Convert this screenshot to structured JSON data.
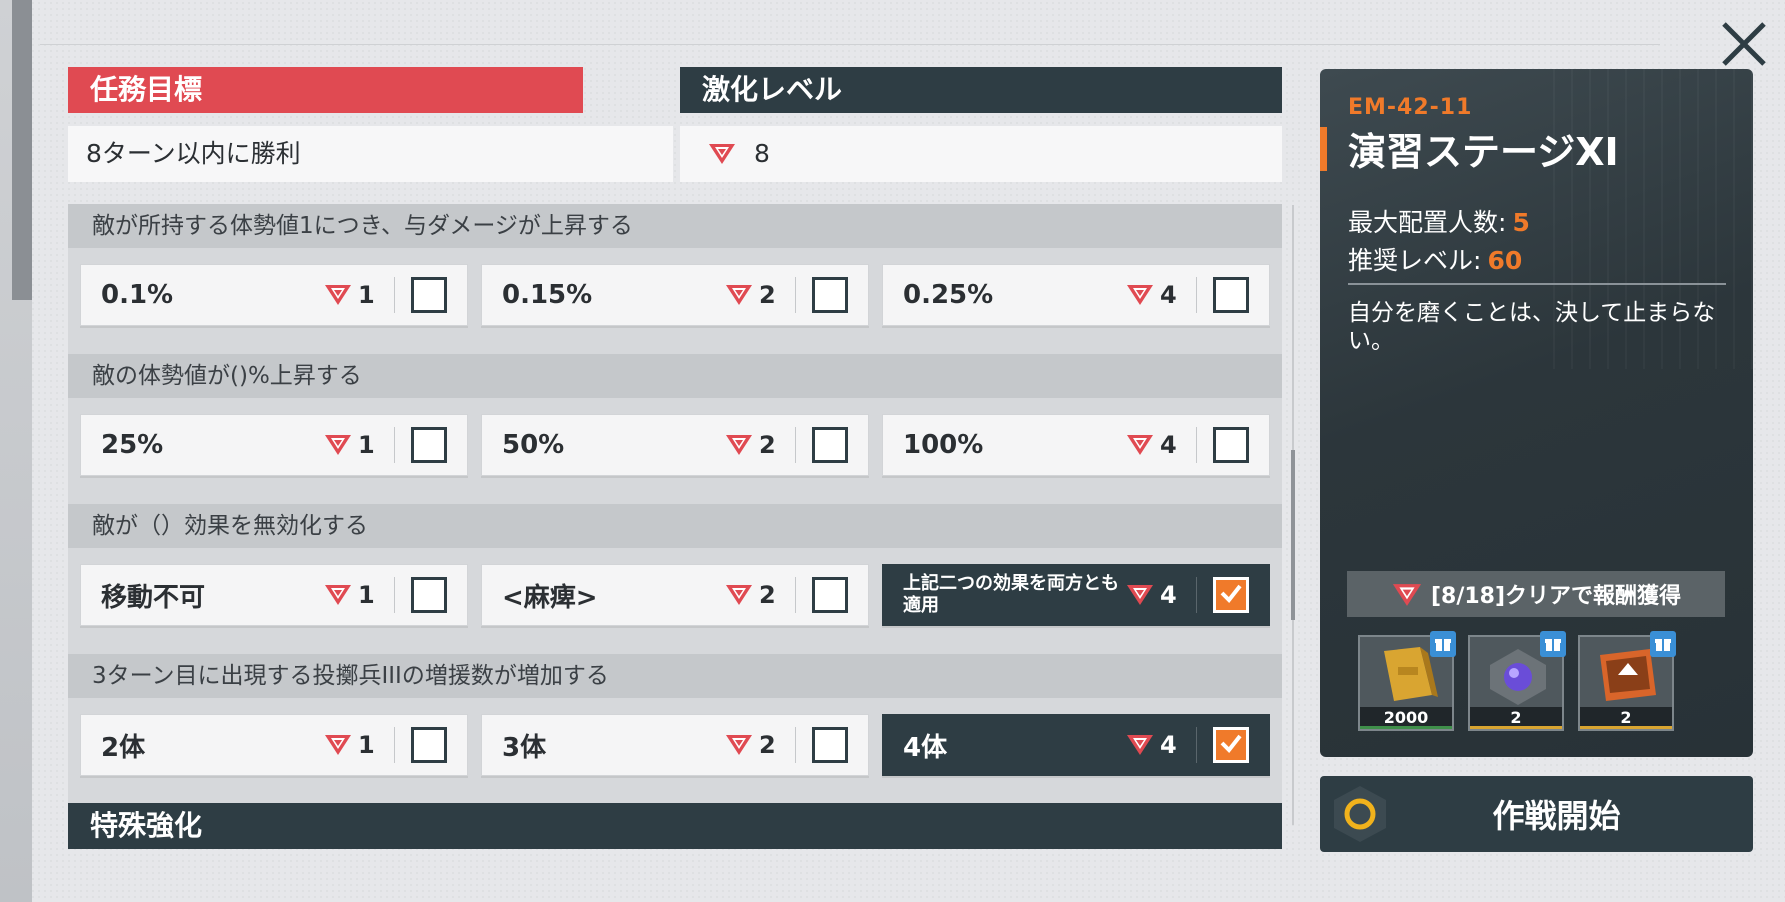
{
  "objective": {
    "title": "任務目標",
    "value": "8ターン以内に勝利"
  },
  "intensity": {
    "title": "激化レベル",
    "value": "8"
  },
  "sections": [
    {
      "title": "敵が所持する体勢値1につき、与ダメージが上昇する",
      "options": [
        {
          "label": "0.1%",
          "cost": "1",
          "checked": false
        },
        {
          "label": "0.15%",
          "cost": "2",
          "checked": false
        },
        {
          "label": "0.25%",
          "cost": "4",
          "checked": false
        }
      ]
    },
    {
      "title": "敵の体勢値が()%上昇する",
      "options": [
        {
          "label": "25%",
          "cost": "1",
          "checked": false
        },
        {
          "label": "50%",
          "cost": "2",
          "checked": false
        },
        {
          "label": "100%",
          "cost": "4",
          "checked": false
        }
      ]
    },
    {
      "title": "敵が（）効果を無効化する",
      "options": [
        {
          "label": "移動不可",
          "cost": "1",
          "checked": false
        },
        {
          "label": "<麻痺>",
          "cost": "2",
          "checked": false
        },
        {
          "label": "上記二つの効果を両方とも適用",
          "cost": "4",
          "checked": true
        }
      ]
    },
    {
      "title": "3ターン目に出現する投擲兵IIIの増援数が増加する",
      "options": [
        {
          "label": "2体",
          "cost": "1",
          "checked": false
        },
        {
          "label": "3体",
          "cost": "2",
          "checked": false
        },
        {
          "label": "4体",
          "cost": "4",
          "checked": true
        }
      ]
    }
  ],
  "special": {
    "title": "特殊強化"
  },
  "stage": {
    "id": "EM-42-11",
    "name": "演習ステージXI",
    "max_deploy_label": "最大配置人数:",
    "max_deploy": "5",
    "rec_level_label": "推奨レベル:",
    "rec_level": "60",
    "description": "自分を磨くことは、決して止まらない。"
  },
  "reward": {
    "label": "[8/18]クリアで報酬獲得",
    "items": [
      {
        "icon": "gold-bar-icon",
        "count": "2000",
        "rarity_color": "#3f8f4a"
      },
      {
        "icon": "purple-crystal-icon",
        "count": "2",
        "rarity_color": "#d9a531"
      },
      {
        "icon": "upgrade-chip-icon",
        "count": "2",
        "rarity_color": "#d9a531"
      }
    ]
  },
  "start": {
    "label": "作戦開始"
  },
  "colors": {
    "accent": "#f07a2a",
    "red": "#e04a52",
    "dark": "#2e3d44"
  }
}
